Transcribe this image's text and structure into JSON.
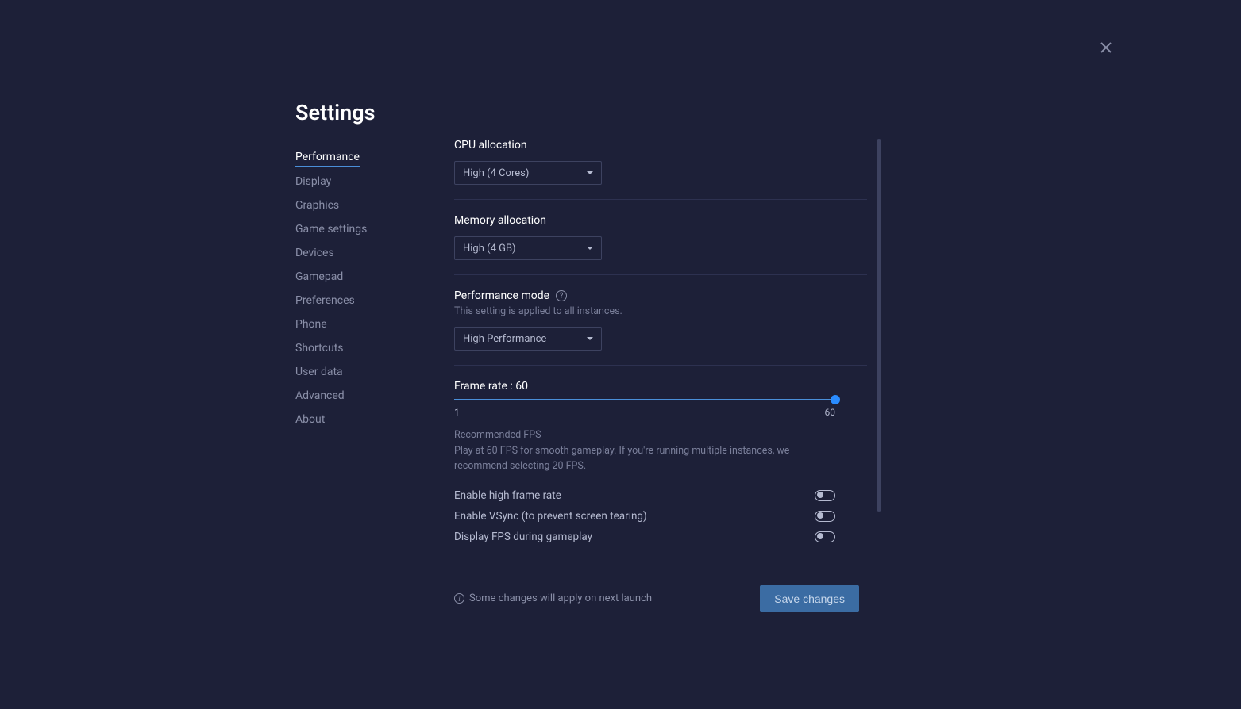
{
  "title": "Settings",
  "nav": {
    "items": [
      "Performance",
      "Display",
      "Graphics",
      "Game settings",
      "Devices",
      "Gamepad",
      "Preferences",
      "Phone",
      "Shortcuts",
      "User data",
      "Advanced",
      "About"
    ],
    "active_index": 0
  },
  "sections": {
    "cpu": {
      "label": "CPU allocation",
      "value": "High (4 Cores)"
    },
    "memory": {
      "label": "Memory allocation",
      "value": "High (4 GB)"
    },
    "perf_mode": {
      "label": "Performance mode",
      "sublabel": "This setting is applied to all instances.",
      "value": "High Performance"
    },
    "frame_rate": {
      "label": "Frame rate : 60",
      "min": "1",
      "max": "60",
      "recommend_title": "Recommended FPS",
      "recommend_text": "Play at 60 FPS for smooth gameplay. If you're running multiple instances, we recommend selecting 20 FPS."
    }
  },
  "toggles": [
    {
      "label": "Enable high frame rate"
    },
    {
      "label": "Enable VSync (to prevent screen tearing)"
    },
    {
      "label": "Display FPS during gameplay"
    }
  ],
  "footer": {
    "note": "Some changes will apply on next launch",
    "save_label": "Save changes"
  }
}
